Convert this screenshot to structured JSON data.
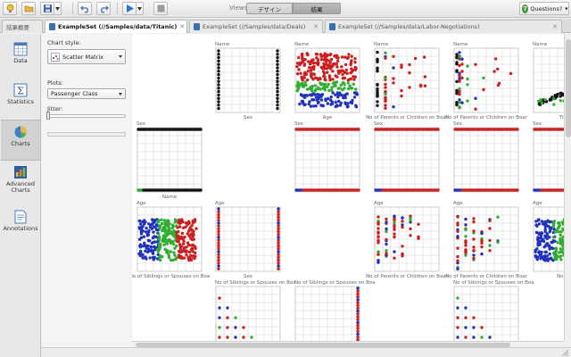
{
  "toolbar": {
    "views_label": "Views:",
    "view_design": "デザイン",
    "view_result": "結果",
    "help_label": "Questions?"
  },
  "tabs": [
    {
      "label": "結果概要",
      "active": false
    },
    {
      "label": "ExampleSet (//Samples/data/Titanic)",
      "active": true
    },
    {
      "label": "ExampleSet (//Samples/data/Deals)",
      "active": false
    },
    {
      "label": "ExampleSet (//Samples/data/Labor-Negotiations)",
      "active": false
    }
  ],
  "nav": [
    {
      "label": "Data",
      "icon": "data-table-icon"
    },
    {
      "label": "Statistics",
      "icon": "statistics-sigma-icon"
    },
    {
      "label": "Charts",
      "icon": "charts-pie-icon",
      "active": true
    },
    {
      "label": "Advanced Charts",
      "icon": "advanced-charts-icon"
    },
    {
      "label": "Annotations",
      "icon": "annotations-note-icon"
    }
  ],
  "config": {
    "chart_style_label": "Chart style:",
    "chart_style_value": "Scatter Matrix",
    "plots_label": "Plots:",
    "plots_value": "Passenger Class",
    "jitter_label": "Jitter:"
  },
  "colors": {
    "red": "#cc1f1f",
    "green": "#2fae2f",
    "blue": "#2233bb",
    "black": "#111111",
    "grid": "#cfcfcf"
  },
  "chart_data": {
    "type": "scatter",
    "color_by": "Passenger Class",
    "cells": [
      {
        "row": 0,
        "col": 0,
        "top_label": "Name",
        "bottom_label": "Sex"
      },
      {
        "row": 0,
        "col": 1,
        "top_label": "Name",
        "bottom_label": "Age"
      },
      {
        "row": 0,
        "col": 2,
        "top_label": "Name",
        "bottom_label": "No of Parents or Children on Boar"
      },
      {
        "row": 0,
        "col": 3,
        "top_label": "Name",
        "bottom_label": "No of Parents or Children on Boar"
      },
      {
        "row": 0,
        "col": 4,
        "top_label": "Name",
        "bottom_label": "Ticke"
      },
      {
        "row": 1,
        "col": -1,
        "top_label": "Sex",
        "bottom_label": "Name"
      },
      {
        "row": 1,
        "col": 1,
        "top_label": "Sex",
        "bottom_label": ""
      },
      {
        "row": 1,
        "col": 2,
        "top_label": "Sex",
        "bottom_label": ""
      },
      {
        "row": 1,
        "col": 3,
        "top_label": "Sex",
        "bottom_label": ""
      },
      {
        "row": 1,
        "col": 4,
        "top_label": "Sex",
        "bottom_label": ""
      },
      {
        "row": 2,
        "col": -1,
        "top_label": "Age",
        "bottom_label": "No of Siblings or Spouses on Boa"
      },
      {
        "row": 2,
        "col": 0,
        "top_label": "Age",
        "bottom_label": "Sex"
      },
      {
        "row": 2,
        "col": 2,
        "top_label": "Age",
        "bottom_label": "No of Parents or Children on Boar"
      },
      {
        "row": 2,
        "col": 3,
        "top_label": "Age",
        "bottom_label": "No of Parents or Children on Boar"
      },
      {
        "row": 2,
        "col": 4,
        "top_label": "Age",
        "bottom_label": "No of S"
      },
      {
        "row": 3,
        "col": 0,
        "top_label": "No of Siblings or Spouses on Boa",
        "bottom_label": ""
      },
      {
        "row": 3,
        "col": 1,
        "top_label": "No of Siblings or Spouses on Boa",
        "bottom_label": ""
      },
      {
        "row": 3,
        "col": 3,
        "top_label": "No of Siblings or Spouses on Boa",
        "bottom_label": ""
      }
    ]
  }
}
